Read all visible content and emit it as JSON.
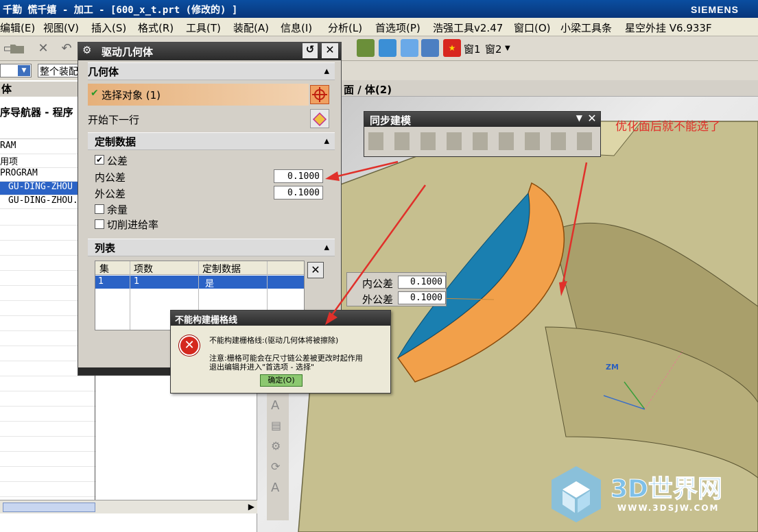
{
  "window": {
    "title": "千勤 慌千嬉 - 加工 - [600_x_t.prt (修改的) ]",
    "brand": "SIEMENS"
  },
  "menu": [
    "编辑(E)",
    "视图(V)",
    "插入(S)",
    "格式(R)",
    "工具(T)",
    "装配(A)",
    "信息(I)",
    "分析(L)",
    "首选项(P)",
    "浩强工具v2.47",
    "窗口(O)",
    "小梁工具条",
    "星空外挂 V6.933F"
  ],
  "toolbar": {
    "window1": "窗1",
    "window2": "窗2",
    "assembly_select": "整个装配"
  },
  "navigator": {
    "header": "体",
    "title": "序导航器 - 程序",
    "rows": [
      "RAM",
      "用项",
      "PROGRAM",
      "GU-DING-ZHOU",
      "GU-DING-ZHOU."
    ]
  },
  "viewport": {
    "header": "面 / 体(2)",
    "annotation": "优化面后就不能选了",
    "tol_inner_label": "内公差",
    "tol_inner_value": "0.1000",
    "tol_outer_label": "外公差",
    "tol_outer_value": "0.1000",
    "axis_label": "ZM"
  },
  "sync_toolbar": {
    "title": "同步建模"
  },
  "dialog": {
    "title": "驱动几何体",
    "geometry_section": "几何体",
    "select_object": "选择对象 (1)",
    "start_next_row": "开始下一行",
    "custom_data_section": "定制数据",
    "tolerance_label": "公差",
    "inner_tol_label": "内公差",
    "inner_tol_value": "0.1000",
    "outer_tol_label": "外公差",
    "outer_tol_value": "0.1000",
    "stock_label": "余量",
    "feed_label": "切削进给率",
    "list_section": "列表",
    "table_headers": [
      "集",
      "项数",
      "定制数据"
    ],
    "table_row": [
      "1",
      "1",
      "是"
    ],
    "tolerance_checked": true,
    "stock_checked": false,
    "feed_checked": false
  },
  "error": {
    "title": "不能构建栅格线",
    "message": "不能构建栅格线:(驱动几何体将被擦除)",
    "note1": "注意:栅格可能会在尺寸链公差被更改时起作用",
    "note2": "退出编辑并进入\"首选项 - 选择\"",
    "ok": "确定(O)"
  },
  "watermark": {
    "text": "3D世界网",
    "url": "WWW.3DSJW.COM"
  },
  "colors": {
    "title_blue": "#08357a",
    "model_khaki": "#c8c08c",
    "face_blue": "#1a7fb0",
    "face_orange": "#f2a04a",
    "annotation_red": "#e0302a"
  }
}
